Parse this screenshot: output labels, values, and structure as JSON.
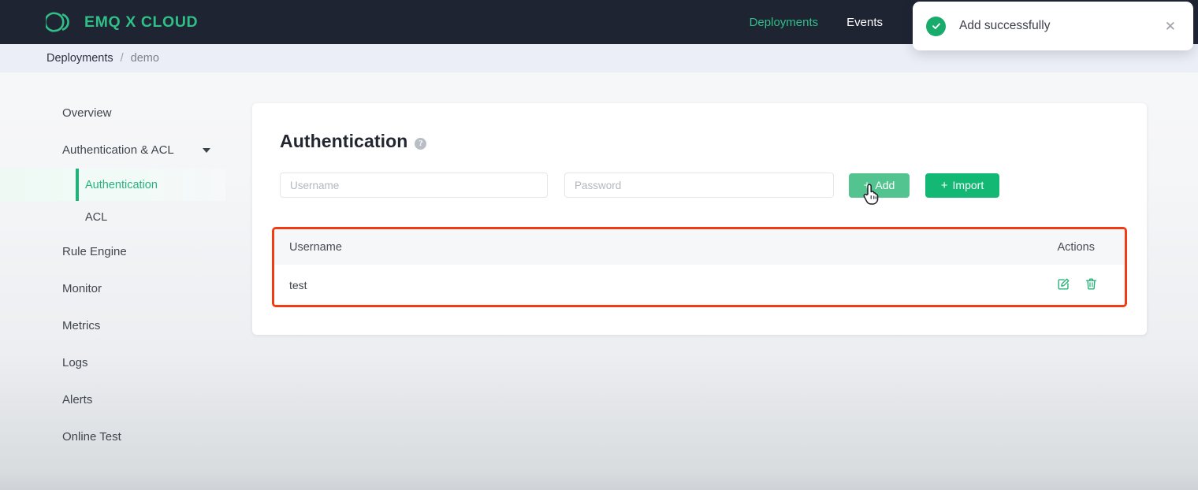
{
  "brand": {
    "name": "EMQ X CLOUD",
    "logo_icon": "emqx-logo-icon",
    "color": "#2fbf87"
  },
  "topnav": {
    "items": [
      {
        "label": "Deployments",
        "active": true
      },
      {
        "label": "Events",
        "active": false
      }
    ]
  },
  "toast": {
    "icon": "check-circle-icon",
    "message": "Add successfully",
    "close_icon": "close-icon",
    "accent": "#18ab6b"
  },
  "breadcrumb": {
    "root": "Deployments",
    "separator": "/",
    "leaf": "demo"
  },
  "sidebar": {
    "items": [
      {
        "label": "Overview",
        "type": "item"
      },
      {
        "label": "Authentication & ACL",
        "type": "item",
        "expandable": true,
        "caret_icon": "chevron-down-icon"
      },
      {
        "label": "Authentication",
        "type": "sub",
        "active": true
      },
      {
        "label": "ACL",
        "type": "sub",
        "active": false
      },
      {
        "label": "Rule Engine",
        "type": "item"
      },
      {
        "label": "Monitor",
        "type": "item"
      },
      {
        "label": "Metrics",
        "type": "item"
      },
      {
        "label": "Logs",
        "type": "item"
      },
      {
        "label": "Alerts",
        "type": "item"
      },
      {
        "label": "Online Test",
        "type": "item"
      }
    ],
    "active_color": "#26b37e"
  },
  "main": {
    "title": "Authentication",
    "help_icon": "question-mark-icon",
    "help_glyph": "?",
    "form": {
      "username": {
        "value": "",
        "placeholder": "Username"
      },
      "password": {
        "value": "",
        "placeholder": "Password"
      },
      "add_button": {
        "label": "Add",
        "plus": "+",
        "icon": "plus-icon",
        "color": "#53c48f"
      },
      "import_button": {
        "label": "Import",
        "plus": "+",
        "icon": "plus-icon",
        "color": "#12b873"
      }
    },
    "table": {
      "highlight_color": "#f23b13",
      "columns": [
        "Username",
        "Actions"
      ],
      "rows": [
        {
          "username": "test",
          "edit_icon": "edit-icon",
          "delete_icon": "trash-icon"
        }
      ],
      "action_icon_color": "#2ab37c"
    }
  },
  "cursor": {
    "icon": "pointer-hand-cursor"
  }
}
